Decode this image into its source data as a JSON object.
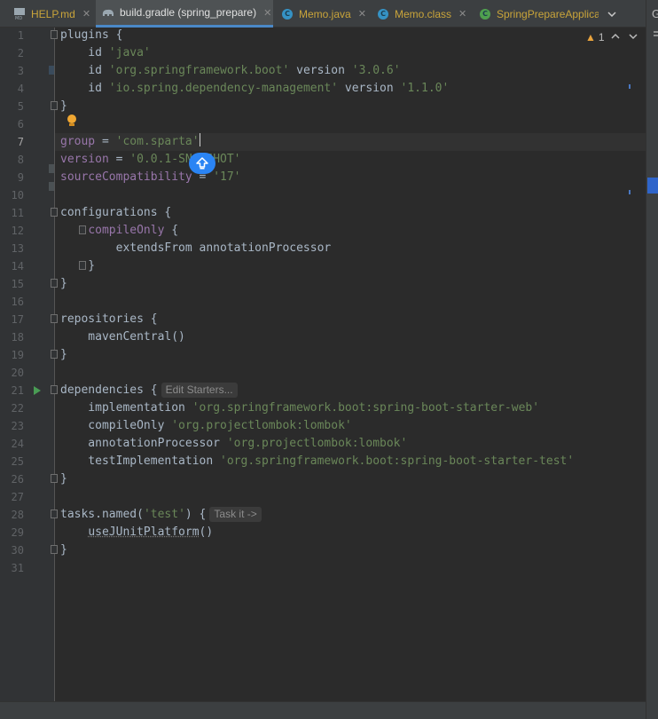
{
  "tabs": [
    {
      "label": "HELP.md",
      "icon": "markdown-file-icon",
      "color": "#c9a43a"
    },
    {
      "label": "build.gradle (spring_prepare)",
      "icon": "gradle-elephant-icon",
      "color": "#c0c8d0"
    },
    {
      "label": "Memo.java",
      "icon": "class-c-icon",
      "color": "#c9a43a"
    },
    {
      "label": "Memo.class",
      "icon": "class-c-icon",
      "color": "#c9a43a"
    },
    {
      "label": "SpringPrepareApplicat",
      "icon": "spring-class-icon",
      "color": "#c9a43a"
    }
  ],
  "right_strip_label": "G",
  "inspections": {
    "warning_count": "1"
  },
  "line_numbers": [
    "1",
    "2",
    "3",
    "4",
    "5",
    "6",
    "7",
    "8",
    "9",
    "10",
    "11",
    "12",
    "13",
    "14",
    "15",
    "16",
    "17",
    "18",
    "19",
    "20",
    "21",
    "22",
    "23",
    "24",
    "25",
    "26",
    "27",
    "28",
    "29",
    "30",
    "31"
  ],
  "current_line": "7",
  "code": {
    "l1_a": "plugins",
    "l1_b": " {",
    "l2_a": "    id ",
    "l2_b": "'java'",
    "l3_a": "    id ",
    "l3_b": "'org.springframework.boot'",
    "l3_c": " version ",
    "l3_d": "'3.0.6'",
    "l4_a": "    id ",
    "l4_b": "'io.spring.dependency-management'",
    "l4_c": " version ",
    "l4_d": "'1.1.0'",
    "l5": "}",
    "l7_a": "group",
    "l7_b": " = ",
    "l7_c": "'com.sparta'",
    "l8_a": "version",
    "l8_b": " = ",
    "l8_c": "'0.0.1-SNAPSHOT'",
    "l9_a": "sourceCompatibility",
    "l9_b": " = ",
    "l9_c": "'17'",
    "l11": "configurations {",
    "l12_a": "    ",
    "l12_b": "compileOnly",
    "l12_c": " {",
    "l13": "        extendsFrom annotationProcessor",
    "l14": "    }",
    "l15": "}",
    "l17": "repositories {",
    "l18": "    mavenCentral()",
    "l19": "}",
    "l21": "dependencies {",
    "l21_hint": "Edit Starters...",
    "l22_a": "    implementation ",
    "l22_b": "'org.springframework.boot:spring-boot-starter-web'",
    "l23_a": "    compileOnly ",
    "l23_b": "'org.projectlombok:lombok'",
    "l24_a": "    annotationProcessor ",
    "l24_b": "'org.projectlombok:lombok'",
    "l25_a": "    testImplementation ",
    "l25_b": "'org.springframework.boot:spring-boot-starter-test'",
    "l26": "}",
    "l28_a": "tasks",
    "l28_b": ".named(",
    "l28_c": "'test'",
    "l28_d": ") {",
    "l28_hint": "Task it ->",
    "l29_a": "    ",
    "l29_b": "useJUnitPlatform",
    "l29_c": "()",
    "l30": "}"
  },
  "colors": {
    "background": "#2b2b2b",
    "keyword": "#cc7832",
    "string": "#6a8759",
    "property": "#9876aa",
    "accent": "#4a88c7",
    "float_button": "#2a84f4"
  }
}
